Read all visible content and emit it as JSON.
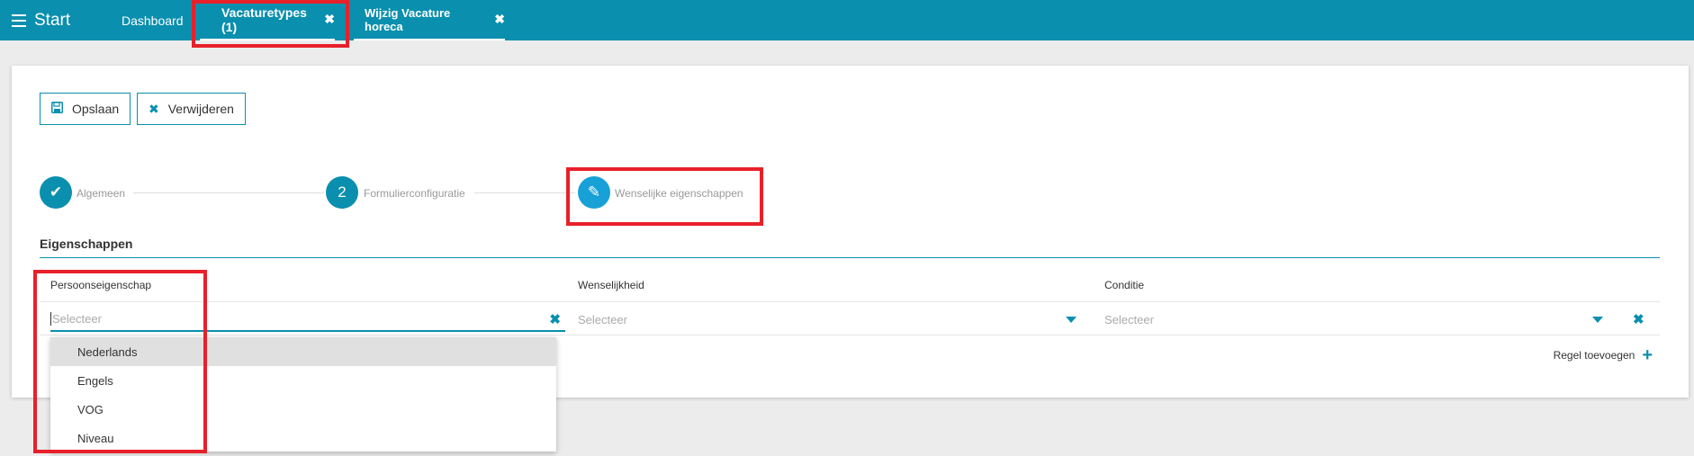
{
  "topbar": {
    "menu_label": "Start",
    "tabs": [
      {
        "label": "Dashboard"
      },
      {
        "label": "Vacaturetypes (1)",
        "closable": true
      },
      {
        "label": "Wijzig Vacature horeca",
        "closable": true
      }
    ]
  },
  "toolbar": {
    "save_label": "Opslaan",
    "delete_label": "Verwijderen"
  },
  "stepper": {
    "steps": [
      {
        "label": "Algemeen",
        "state": "done",
        "marker": "✔"
      },
      {
        "label": "Formulierconfiguratie",
        "state": "number",
        "marker": "2"
      },
      {
        "label": "Wenselijke eigenschappen",
        "state": "active",
        "marker": "✎"
      }
    ]
  },
  "section": {
    "title": "Eigenschappen"
  },
  "table": {
    "columns": [
      "Persoonseigenschap",
      "Wenselijkheid",
      "Conditie"
    ],
    "row": {
      "persoonseigenschap_placeholder": "Selecteer",
      "wenselijkheid_placeholder": "Selecteer",
      "conditie_placeholder": "Selecteer"
    },
    "add_row_label": "Regel toevoegen"
  },
  "dropdown": {
    "options": [
      "Nederlands",
      "Engels",
      "VOG",
      "Niveau"
    ],
    "hovered_index": 0
  },
  "colors": {
    "accent": "#0a8fae",
    "highlight": "#e8202a",
    "background": "#ececec"
  }
}
